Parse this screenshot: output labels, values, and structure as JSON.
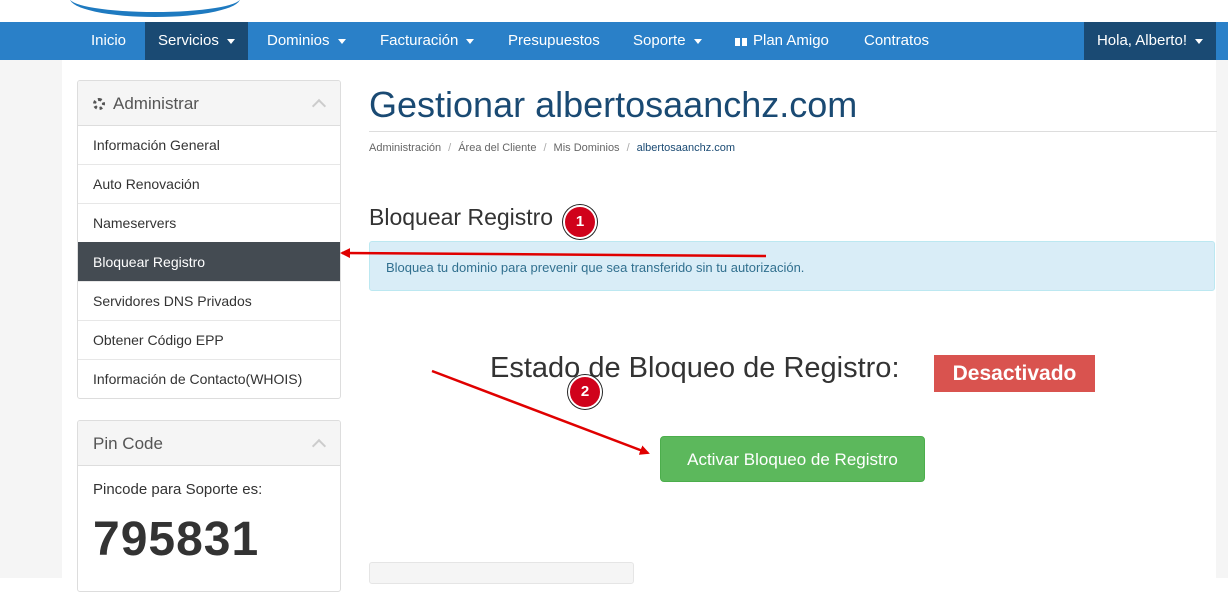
{
  "nav": {
    "items": [
      {
        "label": "Inicio",
        "dropdown": false
      },
      {
        "label": "Servicios",
        "dropdown": true
      },
      {
        "label": "Dominios",
        "dropdown": true
      },
      {
        "label": "Facturación",
        "dropdown": true
      },
      {
        "label": "Presupuestos",
        "dropdown": false
      },
      {
        "label": "Soporte",
        "dropdown": true
      },
      {
        "label": "Plan Amigo",
        "dropdown": false,
        "icon": "gift-icon"
      },
      {
        "label": "Contratos",
        "dropdown": false
      }
    ],
    "user": "Hola, Alberto!"
  },
  "sidebar": {
    "admin_title": "Administrar",
    "items": [
      "Información General",
      "Auto Renovación",
      "Nameservers",
      "Bloquear Registro",
      "Servidores DNS Privados",
      "Obtener Código EPP",
      "Información de Contacto(WHOIS)"
    ],
    "active_item": "Bloquear Registro",
    "pin": {
      "title": "Pin Code",
      "label": "Pincode para Soporte es:",
      "code": "795831"
    }
  },
  "main": {
    "title": "Gestionar albertosaanchz.com",
    "breadcrumb": [
      "Administración",
      "Área del Cliente",
      "Mis Dominios",
      "albertosaanchz.com"
    ],
    "section_title": "Bloquear Registro",
    "alert": "Bloquea tu dominio para prevenir que sea transferido sin tu autorización.",
    "status_label": "Estado de Bloqueo de Registro:",
    "status_value": "Desactivado",
    "activate_button": "Activar Bloqueo de Registro"
  },
  "annotations": {
    "callout_1": "1",
    "callout_2": "2"
  },
  "colors": {
    "nav": "#2a80c8",
    "nav_active": "#1a4a73",
    "danger": "#d9534f",
    "success": "#5cb85c",
    "annotation": "#d0021b"
  }
}
